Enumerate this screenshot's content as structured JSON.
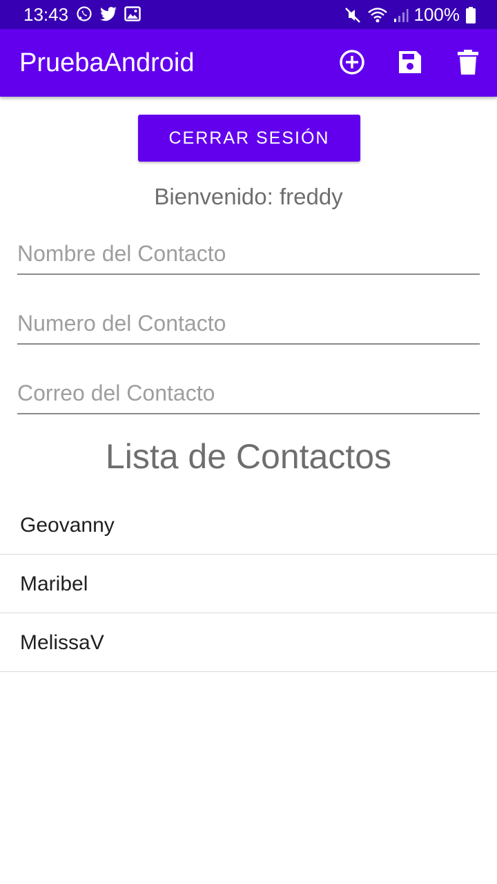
{
  "status_bar": {
    "time": "13:43",
    "battery": "100%",
    "icons_left": [
      "whatsapp-icon",
      "twitter-icon",
      "gallery-icon"
    ],
    "icons_right": [
      "mute-icon",
      "wifi-icon",
      "signal-icon",
      "battery-icon"
    ]
  },
  "appbar": {
    "title": "PruebaAndroid",
    "actions": [
      "add-circle-icon",
      "save-icon",
      "delete-icon"
    ]
  },
  "logout_button": "CERRAR SESIÓN",
  "welcome": {
    "label": "Bienvenido:",
    "user": "freddy"
  },
  "form": {
    "name_placeholder": "Nombre del Contacto",
    "number_placeholder": "Numero del Contacto",
    "email_placeholder": "Correo del Contacto"
  },
  "contacts": {
    "title": "Lista de Contactos",
    "items": [
      "Geovanny",
      "Maribel",
      "MelissaV"
    ]
  },
  "colors": {
    "primary": "#6200ee",
    "primary_dark": "#3700b3"
  }
}
